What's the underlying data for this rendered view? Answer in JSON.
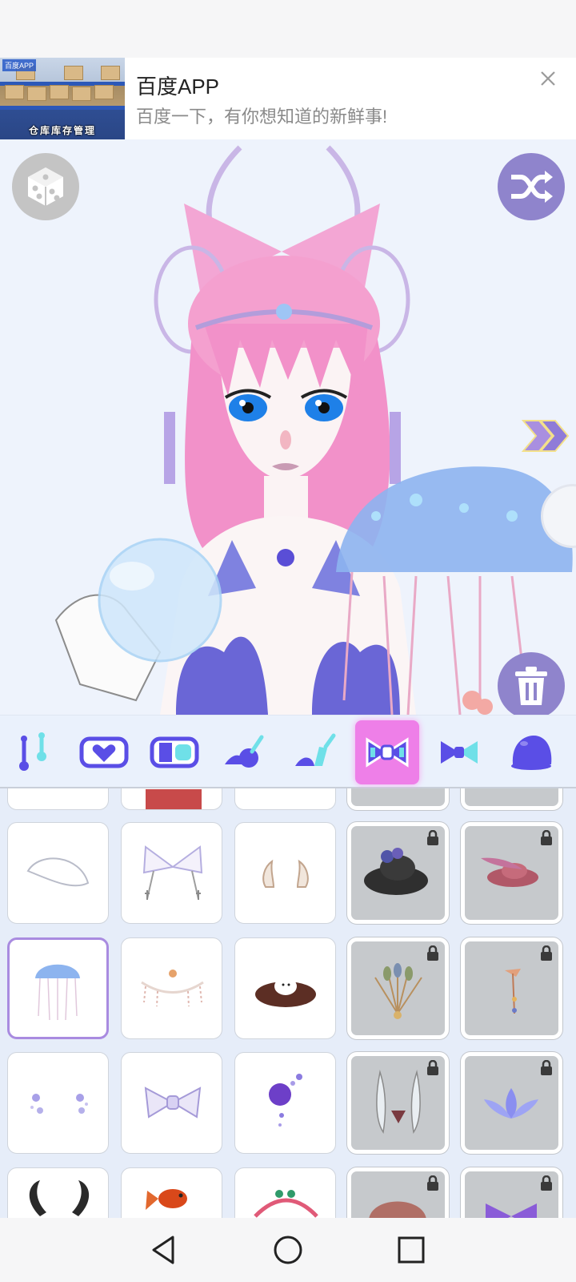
{
  "ad": {
    "title": "百度APP",
    "subtitle": "百度一下，有你想知道的新鲜事!",
    "thumb_brand": "百度APP",
    "thumb_caption": "仓库库存管理",
    "close_icon": "close-icon"
  },
  "toolbar": {
    "random_icon": "dice-icon",
    "shuffle_icon": "shuffle-icon",
    "next_icon": "double-chevron-right-icon",
    "delete_icon": "trash-icon"
  },
  "categories": [
    {
      "icon": "piercing-icon"
    },
    {
      "icon": "heart-badge-icon"
    },
    {
      "icon": "band-icon"
    },
    {
      "icon": "hair-clip-icon"
    },
    {
      "icon": "hair-pin-icon"
    },
    {
      "icon": "bow-icon",
      "active": true
    },
    {
      "icon": "small-bow-icon"
    },
    {
      "icon": "cap-icon"
    }
  ],
  "items": [
    {
      "icon": "white-cap-item",
      "locked": false
    },
    {
      "icon": "lace-ribbon-item",
      "locked": false
    },
    {
      "icon": "small-horns-item",
      "locked": false
    },
    {
      "icon": "rose-hat-item",
      "locked": true
    },
    {
      "icon": "feather-hat-item",
      "locked": true
    },
    {
      "icon": "jellyfish-hat-item",
      "locked": false,
      "selected": true
    },
    {
      "icon": "pearl-chain-item",
      "locked": false
    },
    {
      "icon": "bird-nest-item",
      "locked": false
    },
    {
      "icon": "peacock-crown-item",
      "locked": true
    },
    {
      "icon": "hairpin-item",
      "locked": true
    },
    {
      "icon": "flower-sparkles-item",
      "locked": false
    },
    {
      "icon": "lilac-bow-item",
      "locked": false
    },
    {
      "icon": "purple-rose-item",
      "locked": false
    },
    {
      "icon": "wing-clip-item",
      "locked": true
    },
    {
      "icon": "lotus-item",
      "locked": true
    },
    {
      "icon": "black-horns-item",
      "locked": false
    },
    {
      "icon": "goldfish-item",
      "locked": false
    },
    {
      "icon": "berry-headband-item",
      "locked": false
    },
    {
      "icon": "mushroom-hat-item",
      "locked": true
    },
    {
      "icon": "purple-bow-item",
      "locked": true
    }
  ],
  "colors": {
    "accent": "#8f84cc",
    "active_tab": "#ee7fe8",
    "icon_blue": "#5a4ee6",
    "icon_cyan": "#6fe0e8"
  },
  "nav": {
    "back_icon": "back-icon",
    "home_icon": "home-icon",
    "recents_icon": "recents-icon"
  }
}
